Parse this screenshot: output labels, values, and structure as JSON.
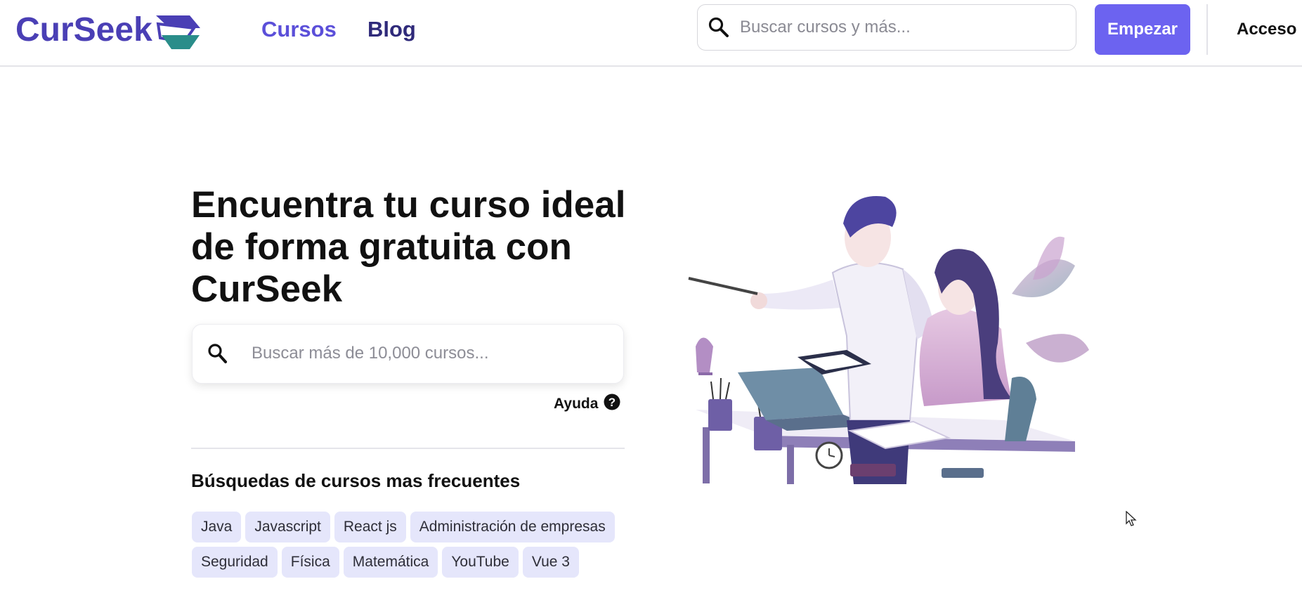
{
  "header": {
    "logo_text": "CurSeek",
    "nav": {
      "cursos": "Cursos",
      "blog": "Blog"
    },
    "search_placeholder": "Buscar cursos y más...",
    "start_button": "Empezar",
    "login_link": "Acceso"
  },
  "hero": {
    "title": "Encuentra tu curso ideal de forma gratuita con CurSeek",
    "search_placeholder": "Buscar más de 10,000 cursos...",
    "help_label": "Ayuda"
  },
  "frequent": {
    "title": "Búsquedas de cursos mas frecuentes",
    "chips": [
      "Java",
      "Javascript",
      "React js",
      "Administración de empresas",
      "Seguridad",
      "Física",
      "Matemática",
      "YouTube",
      "Vue 3"
    ]
  },
  "colors": {
    "accent": "#6c63f0",
    "nav_active": "#5b4fd9",
    "nav_dark": "#2f2a7a",
    "logo_teal": "#2a8d8a",
    "chip_bg": "#e5e6fb"
  },
  "icons": {
    "search": "search-icon",
    "help": "help-circle-icon",
    "logo": "book-stack-icon"
  }
}
